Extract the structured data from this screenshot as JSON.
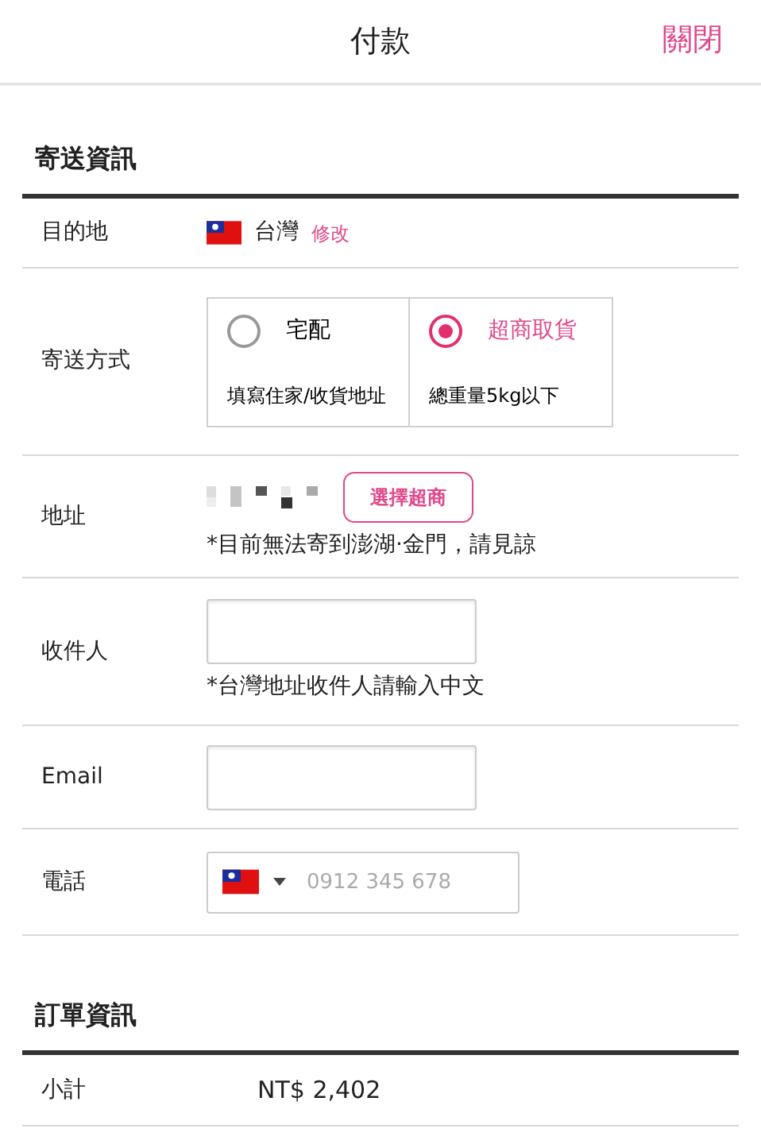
{
  "header": {
    "title": "付款",
    "close": "關閉"
  },
  "shipping": {
    "title": "寄送資訊",
    "rows": [
      {
        "kind": "destination",
        "label": "目的地",
        "country": "台灣",
        "edit": "修改"
      },
      {
        "kind": "method",
        "label": "寄送方式",
        "options": [
          {
            "name": "宅配",
            "note": "填寫住家/收貨地址",
            "selected": false
          },
          {
            "name": "超商取貨",
            "note": "總重量5kg以下",
            "selected": true
          }
        ]
      },
      {
        "kind": "address",
        "label": "地址",
        "button": "選擇超商",
        "note": "*目前無法寄到澎湖·金門，請見諒"
      },
      {
        "kind": "input",
        "label": "收件人",
        "note": "*台灣地址收件人請輸入中文"
      },
      {
        "kind": "input",
        "label": "Email"
      },
      {
        "kind": "phone",
        "label": "電話",
        "placeholder": "0912 345 678"
      }
    ]
  },
  "order": {
    "title": "訂單資訊",
    "rows": [
      {
        "label": "小計",
        "value": "NT$ 2,402"
      }
    ]
  }
}
